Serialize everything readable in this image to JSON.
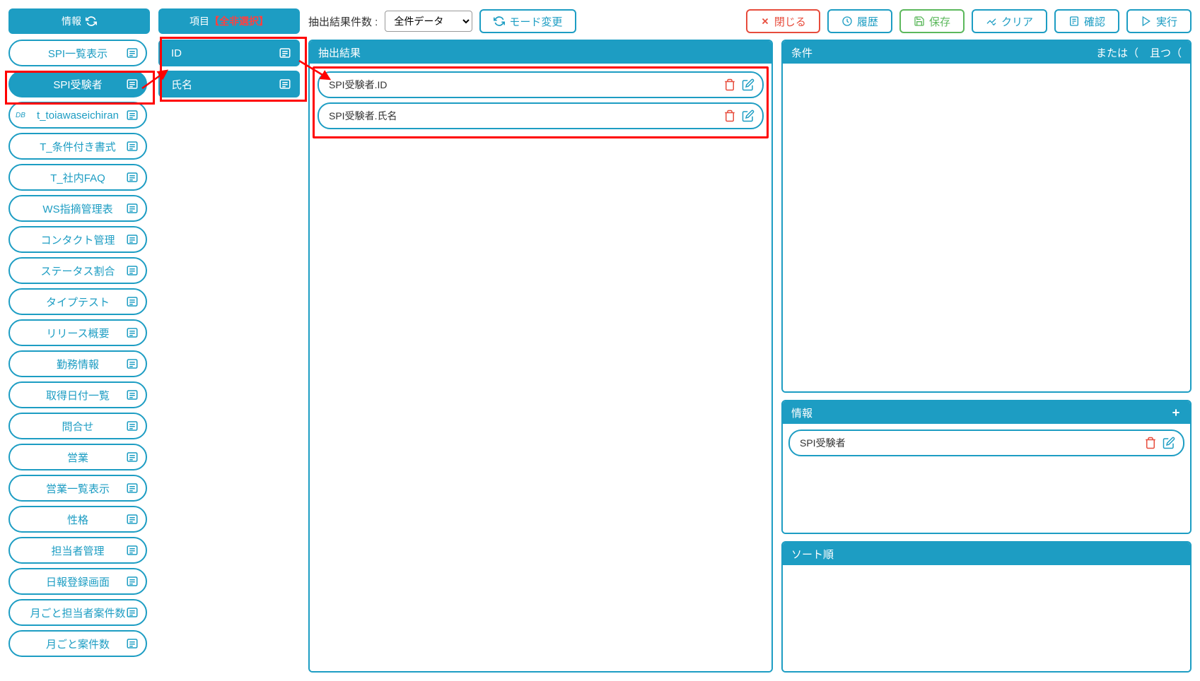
{
  "col1": {
    "header": "情報",
    "items": [
      {
        "label": "SPI一覧表示",
        "sel": false
      },
      {
        "label": "SPI受験者",
        "sel": true
      },
      {
        "label": "t_toiawaseichiran",
        "sel": false,
        "db": true
      },
      {
        "label": "T_条件付き書式",
        "sel": false
      },
      {
        "label": "T_社内FAQ",
        "sel": false
      },
      {
        "label": "WS指摘管理表",
        "sel": false
      },
      {
        "label": "コンタクト管理",
        "sel": false
      },
      {
        "label": "ステータス割合",
        "sel": false
      },
      {
        "label": "タイプテスト",
        "sel": false
      },
      {
        "label": "リリース概要",
        "sel": false
      },
      {
        "label": "勤務情報",
        "sel": false
      },
      {
        "label": "取得日付一覧",
        "sel": false
      },
      {
        "label": "問合せ",
        "sel": false
      },
      {
        "label": "営業",
        "sel": false
      },
      {
        "label": "営業一覧表示",
        "sel": false
      },
      {
        "label": "性格",
        "sel": false
      },
      {
        "label": "担当者管理",
        "sel": false
      },
      {
        "label": "日報登録画面",
        "sel": false
      },
      {
        "label": "月ごと担当者案件数",
        "sel": false
      },
      {
        "label": "月ごと案件数",
        "sel": false
      }
    ]
  },
  "col2": {
    "header_a": "項目",
    "header_b": "【全非選択】",
    "items": [
      {
        "label": "ID"
      },
      {
        "label": "氏名"
      }
    ]
  },
  "toolbar": {
    "count_label": "抽出結果件数 :",
    "select_value": "全件データ",
    "mode": "モード変更",
    "close": "閉じる",
    "history": "履歴",
    "save": "保存",
    "clear": "クリア",
    "confirm": "確認",
    "run": "実行"
  },
  "results": {
    "header": "抽出結果",
    "items": [
      {
        "label": "SPI受験者.ID"
      },
      {
        "label": "SPI受験者.氏名"
      }
    ]
  },
  "cond": {
    "header": "条件",
    "or": "または（",
    "and": "且つ（"
  },
  "info": {
    "header": "情報",
    "items": [
      {
        "label": "SPI受験者"
      }
    ]
  },
  "sort": {
    "header": "ソート順"
  }
}
